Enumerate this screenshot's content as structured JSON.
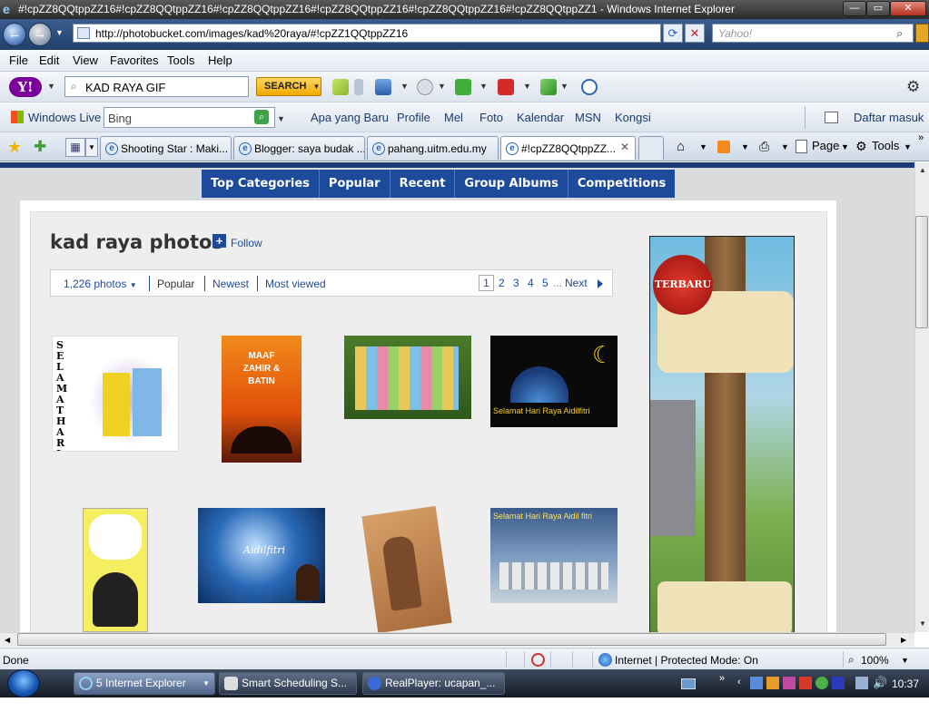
{
  "window": {
    "title": "#!cpZZ8QQtppZZ16#!cpZZ8QQtppZZ16#!cpZZ8QQtppZZ16#!cpZZ8QQtppZZ16#!cpZZ8QQtppZZ16#!cpZZ8QQtppZZ1 - Windows Internet Explorer"
  },
  "address": {
    "url": "http://photobucket.com/images/kad%20raya/#!cpZZ1QQtppZZ16",
    "search_placeholder": "Yahoo!"
  },
  "menu": [
    "File",
    "Edit",
    "View",
    "Favorites",
    "Tools",
    "Help"
  ],
  "yahoo_toolbar": {
    "logo": "Y!",
    "search_value": "KAD RAYA GIF",
    "search_button": "SEARCH"
  },
  "live_toolbar": {
    "brand": "Windows Live",
    "search_value": "Bing",
    "links": [
      "Apa yang Baru",
      "Profile",
      "Mel",
      "Foto",
      "Kalendar",
      "MSN",
      "Kongsi"
    ],
    "signin": "Daftar masuk"
  },
  "tabs": [
    {
      "label": "Shooting Star : Maki..."
    },
    {
      "label": "Blogger: saya budak ..."
    },
    {
      "label": "pahang.uitm.edu.my"
    },
    {
      "label": "#!cpZZ8QQtppZZ..."
    }
  ],
  "commands": {
    "page": "Page",
    "tools": "Tools"
  },
  "site": {
    "nav": [
      "Top Categories",
      "Popular",
      "Recent",
      "Group Albums",
      "Competitions"
    ],
    "page_title": "kad raya photos",
    "follow": "Follow",
    "photo_count": "1,226 photos",
    "sort_options": [
      "Popular",
      "Newest",
      "Most viewed"
    ],
    "pages": [
      "1",
      "2",
      "3",
      "4",
      "5"
    ],
    "ellipsis": "...",
    "next": "Next",
    "ad_badge": "TERBARU",
    "thumbs": [
      {
        "text": "SELAMAT HARI RAYA"
      },
      {
        "text": "MAAF ZAHIR & BATIN"
      },
      {
        "text": ""
      },
      {
        "text": "Selamat Hari Raya Aidilfitri"
      },
      {
        "text": ""
      },
      {
        "text": "Aidilfitri"
      },
      {
        "text": ""
      },
      {
        "text": "Selamat Hari Raya Aidil fitri"
      }
    ]
  },
  "status": {
    "left": "Done",
    "zone": "Internet | Protected Mode: On",
    "zoom": "100%"
  },
  "taskbar": {
    "buttons": [
      {
        "label": "5 Internet Explorer"
      },
      {
        "label": "Smart Scheduling S..."
      },
      {
        "label": "RealPlayer: ucapan_..."
      }
    ],
    "clock": "10:37"
  }
}
